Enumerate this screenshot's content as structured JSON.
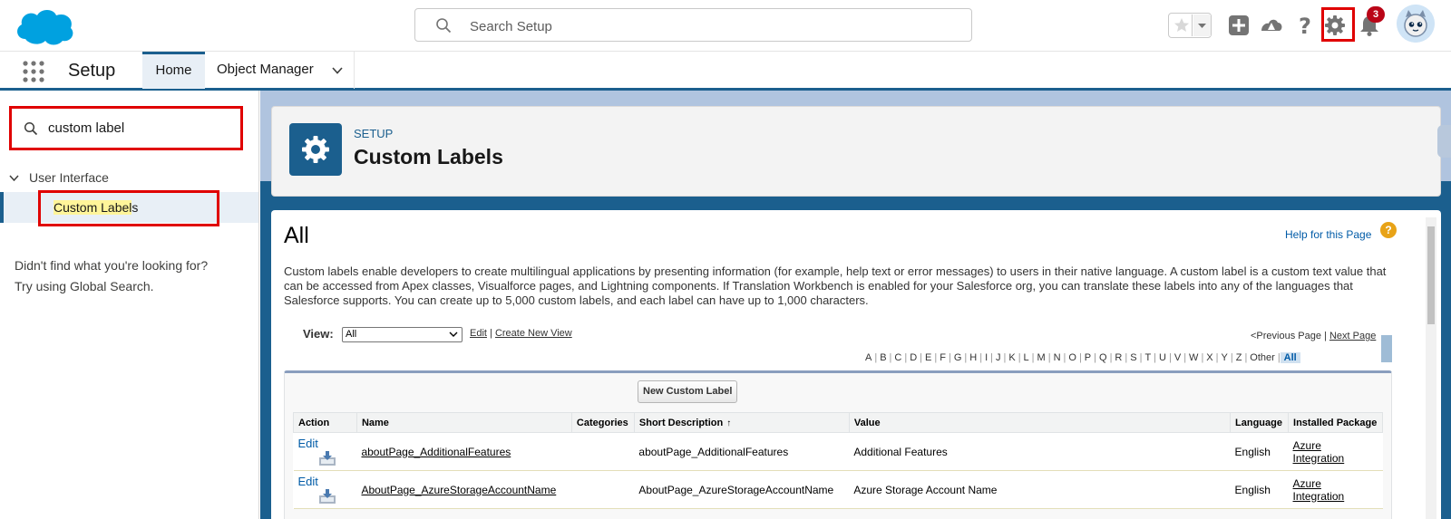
{
  "header": {
    "search_placeholder": "Search Setup",
    "notification_count": "3",
    "help_glyph": "?"
  },
  "context_bar": {
    "app_name": "Setup",
    "tabs": [
      {
        "label": "Home",
        "active": true
      },
      {
        "label": "Object Manager",
        "active": false
      }
    ]
  },
  "sidebar": {
    "quick_find_value": "custom label",
    "section_label": "User Interface",
    "item_match": "Custom Label",
    "item_rest": "s",
    "not_found_line1": "Didn't find what you're looking for?",
    "not_found_line2": "Try using Global Search."
  },
  "page_header": {
    "eyebrow": "SETUP",
    "title": "Custom Labels"
  },
  "content": {
    "title": "All",
    "help_link": "Help for this Page",
    "help_glyph": "?",
    "description": "Custom labels enable developers to create multilingual applications by presenting information (for example, help text or error messages) to users in their native language. A custom label is a custom text value that can be accessed from Apex classes, Visualforce pages, and Lightning components. If Translation Workbench is enabled for your Salesforce org, you can translate these labels into any of the languages that Salesforce supports. You can create up to 5,000 custom labels, and each label can have up to 1,000 characters.",
    "view_label": "View:",
    "view_selected": "All",
    "view_edit": "Edit",
    "view_sep": "|",
    "view_create": "Create New View",
    "pager_prev": "<Previous Page",
    "pager_sep": "|",
    "pager_next": "Next Page",
    "alphabet": [
      "A",
      "B",
      "C",
      "D",
      "E",
      "F",
      "G",
      "H",
      "I",
      "J",
      "K",
      "L",
      "M",
      "N",
      "O",
      "P",
      "Q",
      "R",
      "S",
      "T",
      "U",
      "V",
      "W",
      "X",
      "Y",
      "Z",
      "Other",
      "All"
    ],
    "alphabet_active": "All",
    "new_button": "New Custom Label",
    "columns": [
      "Action",
      "Name",
      "Categories",
      "Short Description",
      "Value",
      "Language",
      "Installed Package"
    ],
    "sort_arrow": "↑",
    "rows": [
      {
        "action": "Edit",
        "name": "aboutPage_AdditionalFeatures",
        "categories": "",
        "short_description": "aboutPage_AdditionalFeatures",
        "value": "Additional Features",
        "language": "English",
        "package_line1": "Azure",
        "package_line2": "Integration"
      },
      {
        "action": "Edit",
        "name": "AboutPage_AzureStorageAccountName",
        "categories": "",
        "short_description": "AboutPage_AzureStorageAccountName",
        "value": "Azure Storage Account Name",
        "language": "English",
        "package_line1": "Azure",
        "package_line2": "Integration"
      }
    ]
  },
  "colors": {
    "brand_blue": "#1b5f8e",
    "cloud_blue": "#00a1e0",
    "highlight_red": "#e00000",
    "link_blue": "#015ba7"
  }
}
